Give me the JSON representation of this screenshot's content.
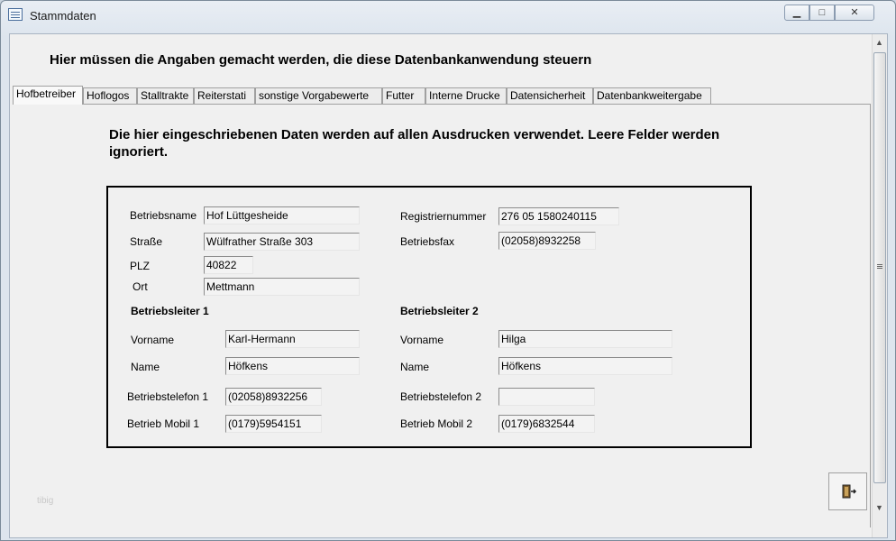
{
  "window": {
    "title": "Stammdaten",
    "min_glyph": "▁",
    "max_glyph": "□",
    "close_glyph": "✕"
  },
  "main": {
    "heading": "Hier müssen die Angaben gemacht werden, die diese Datenbankanwendung steuern",
    "info_text": "Die hier eingeschriebenen Daten werden auf allen Ausdrucken verwendet. Leere Felder werden ignoriert.",
    "footer_text": "tibig"
  },
  "tabs": [
    {
      "label": "Hofbetreiber",
      "active": true
    },
    {
      "label": "Hoflogos"
    },
    {
      "label": "Stalltrakte"
    },
    {
      "label": "Reiterstati"
    },
    {
      "label": "sonstige Vorgabewerte"
    },
    {
      "label": "Futter"
    },
    {
      "label": "Interne Drucke"
    },
    {
      "label": "Datensicherheit"
    },
    {
      "label": "Datenbankweitergabe"
    }
  ],
  "form": {
    "betriebsname": {
      "label": "Betriebsname",
      "value": "Hof Lüttgesheide"
    },
    "strasse": {
      "label": "Straße",
      "value": "Wülfrather Straße 303"
    },
    "plz": {
      "label": "PLZ",
      "value": "40822"
    },
    "ort": {
      "label": "Ort",
      "value": "Mettmann"
    },
    "registriernummer": {
      "label": "Registriernummer",
      "value": "276 05 1580240115"
    },
    "betriebsfax": {
      "label": "Betriebsfax",
      "value": "(02058)8932258"
    },
    "leiter1": {
      "heading": "Betriebsleiter 1",
      "vorname": {
        "label": "Vorname",
        "value": "Karl-Hermann"
      },
      "name": {
        "label": "Name",
        "value": "Höfkens"
      },
      "telefon": {
        "label": "Betriebstelefon 1",
        "value": "(02058)8932256"
      },
      "mobil": {
        "label": "Betrieb Mobil 1",
        "value": "(0179)5954151"
      }
    },
    "leiter2": {
      "heading": "Betriebsleiter 2",
      "vorname": {
        "label": "Vorname",
        "value": "Hilga"
      },
      "name": {
        "label": "Name",
        "value": "Höfkens"
      },
      "telefon": {
        "label": "Betriebstelefon 2",
        "value": ""
      },
      "mobil": {
        "label": "Betrieb Mobil 2",
        "value": "(0179)6832544"
      }
    }
  },
  "icons": {
    "app": "form-icon",
    "exit": "exit-door-icon",
    "scroll_up": "▲",
    "scroll_down": "▼"
  },
  "colors": {
    "title_bar": "#dde5ee",
    "client_bg": "#f0f0f0",
    "frame_border": "#000000"
  }
}
